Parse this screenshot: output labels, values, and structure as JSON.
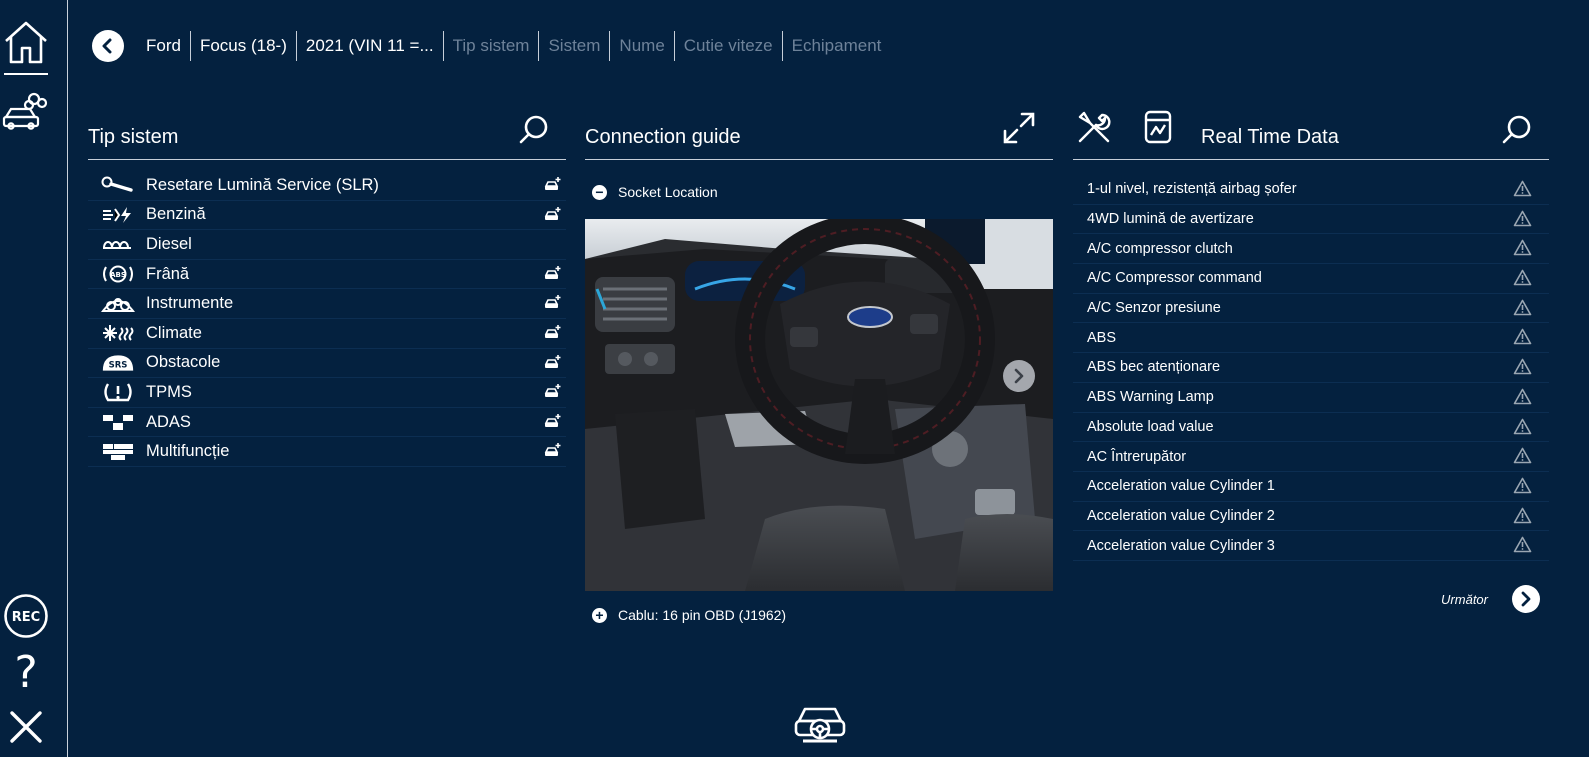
{
  "sidebar": {
    "items": [
      {
        "name": "home-icon"
      },
      {
        "name": "car-diagnostics-icon"
      },
      {
        "name": "rec-icon",
        "label": "REC"
      },
      {
        "name": "help-icon",
        "label": "?"
      },
      {
        "name": "close-icon"
      }
    ]
  },
  "breadcrumb": {
    "items": [
      {
        "label": "Ford",
        "state": "active"
      },
      {
        "label": "Focus (18-)",
        "state": "active"
      },
      {
        "label": "2021 (VIN 11 =...",
        "state": "active"
      },
      {
        "label": "Tip sistem",
        "state": "dim"
      },
      {
        "label": "Sistem",
        "state": "dim"
      },
      {
        "label": "Nume",
        "state": "dim"
      },
      {
        "label": "Cutie viteze",
        "state": "dim"
      },
      {
        "label": "Echipament",
        "state": "dim"
      }
    ]
  },
  "left_panel": {
    "title": "Tip sistem",
    "items": [
      {
        "label": "Resetare Lumină Service (SLR)",
        "icon": "wrench-icon",
        "badge": true
      },
      {
        "label": "Benzină",
        "icon": "petrol-injection-icon",
        "badge": true
      },
      {
        "label": "Diesel",
        "icon": "glow-plug-icon",
        "badge": false
      },
      {
        "label": "Frână",
        "icon": "abs-icon",
        "badge": true
      },
      {
        "label": "Instrumente",
        "icon": "gauge-cluster-icon",
        "badge": true
      },
      {
        "label": "Climate",
        "icon": "climate-icon",
        "badge": true
      },
      {
        "label": "Obstacole",
        "icon": "srs-icon",
        "badge": true
      },
      {
        "label": "TPMS",
        "icon": "tpms-icon",
        "badge": true
      },
      {
        "label": "ADAS",
        "icon": "adas-icon",
        "badge": true
      },
      {
        "label": "Multifuncție",
        "icon": "multifunction-icon",
        "badge": true
      }
    ]
  },
  "center_panel": {
    "title": "Connection guide",
    "socket_label": "Socket Location",
    "socket_sign": "−",
    "cable_label": "Cablu: 16 pin OBD (J1962)",
    "cable_sign": "+"
  },
  "right_panel": {
    "title": "Real Time Data",
    "items": [
      "1-ul nivel, rezistență airbag șofer",
      "4WD lumină de avertizare",
      "A/C compressor clutch",
      "A/C Compressor command",
      "A/C Senzor presiune",
      "ABS",
      "ABS bec atenționare",
      "ABS Warning Lamp",
      "Absolute load value",
      "AC Întrerupător",
      "Acceleration value Cylinder 1",
      "Acceleration value Cylinder 2",
      "Acceleration value Cylinder 3"
    ],
    "next_label": "Următor"
  },
  "colors": {
    "background": "#04213f",
    "text": "#ffffff",
    "dim_text": "#6e8299",
    "divider": "#c6ced8",
    "warning_icon": "#9aa6b2"
  }
}
